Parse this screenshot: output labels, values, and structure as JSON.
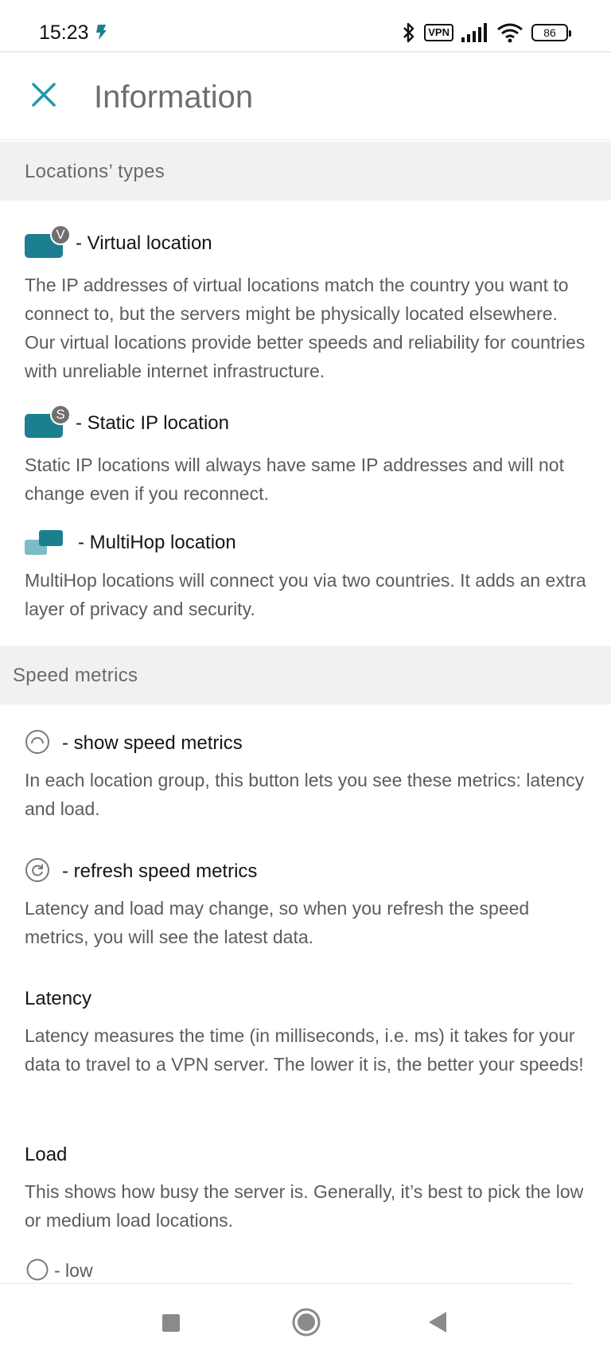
{
  "status_bar": {
    "time": "15:23",
    "vpn_label": "VPN",
    "battery_level": "86",
    "icons": [
      "bluetooth-icon",
      "vpn-icon",
      "signal-icon",
      "wifi-icon",
      "battery-icon"
    ]
  },
  "header": {
    "title": "Information",
    "close_icon": "close-icon"
  },
  "colors": {
    "accent": "#1c7f90",
    "accent_light": "#7bbcc6",
    "section_bg": "#f1f1f1",
    "badge_gray": "#6f6f6f"
  },
  "locations_section": {
    "title": "Locations’ types",
    "virtual": {
      "badge": "V",
      "title": "- Virtual location",
      "description": "The IP addresses of virtual locations match the country you want to connect to, but the servers might be physically located elsewhere. Our virtual locations provide better speeds and reliability for countries with unreliable internet infrastructure."
    },
    "static": {
      "badge": "S",
      "title": "- Static IP location",
      "description": "Static IP locations will always have same IP addresses and will not change even if you reconnect."
    },
    "multihop": {
      "title": "- MultiHop location",
      "description": "MultiHop locations will connect you via two countries. It adds an extra layer of privacy and security."
    }
  },
  "speed_section": {
    "title": "Speed metrics",
    "show": {
      "title": "- show speed metrics",
      "description": "In each location group, this button lets you see these metrics: latency and load."
    },
    "refresh": {
      "title": "- refresh speed metrics",
      "description": "Latency and load may change, so when you refresh the speed metrics, you will see the latest data."
    },
    "latency": {
      "title": "Latency",
      "description": "Latency measures the time (in milliseconds, i.e. ms) it takes for your data to travel to a VPN server. The lower it is, the better your speeds!"
    },
    "load": {
      "title": "Load",
      "description": "This shows how busy the server is. Generally, it’s best to pick the low or medium load locations.",
      "low_label": "- low"
    }
  },
  "nav_bar": {
    "buttons": [
      "recent-apps-icon",
      "home-icon",
      "back-icon"
    ]
  }
}
